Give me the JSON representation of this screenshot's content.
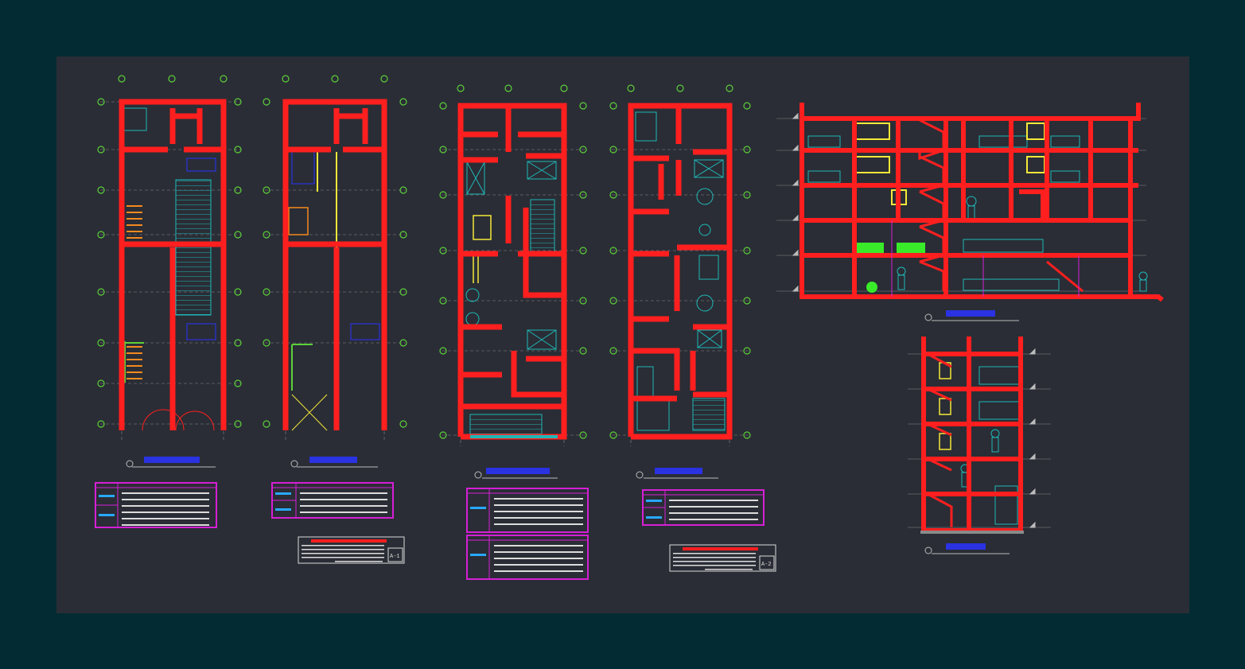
{
  "sheets": [
    {
      "id": "A-1"
    },
    {
      "id": "A-2"
    }
  ],
  "colors": {
    "background": "#022b33",
    "model_space": "#2a2d35",
    "walls": "#ff1f1f",
    "furniture": "#1fb8b8",
    "grid_bubbles": "#5ccf3a",
    "tables": "#d61fd6",
    "titles": "#2a34ff",
    "text_blocks": "#28a8ff",
    "windows": "#f5e83a"
  }
}
